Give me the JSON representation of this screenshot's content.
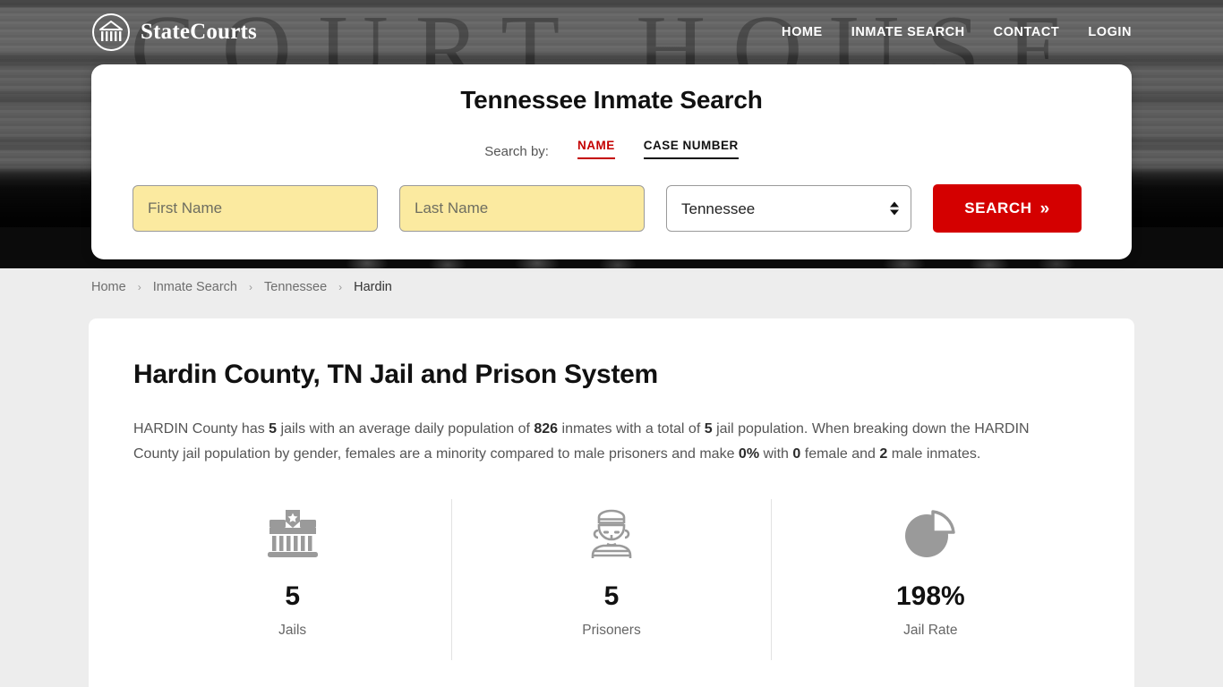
{
  "header": {
    "brand_name": "StateCourts",
    "logo_icon": "courthouse-circle-logo",
    "nav": [
      {
        "label": "HOME"
      },
      {
        "label": "INMATE SEARCH"
      },
      {
        "label": "CONTACT"
      },
      {
        "label": "LOGIN"
      }
    ],
    "background_ghost_text": "COURT HOUSE"
  },
  "search": {
    "title": "Tennessee Inmate Search",
    "search_by_label": "Search by:",
    "tabs": [
      {
        "label": "NAME",
        "active": true,
        "color": "#c40000"
      },
      {
        "label": "CASE NUMBER",
        "active": false,
        "color": "#111111"
      }
    ],
    "first_name": {
      "value": "",
      "placeholder": "First Name"
    },
    "last_name": {
      "value": "",
      "placeholder": "Last Name"
    },
    "state_select": {
      "selected": "Tennessee",
      "options": [
        "Tennessee"
      ]
    },
    "submit_label": "SEARCH",
    "submit_icon": "double-chevron-right-icon",
    "submit_color": "#d40000"
  },
  "breadcrumb": {
    "items": [
      {
        "label": "Home",
        "current": false
      },
      {
        "label": "Inmate Search",
        "current": false
      },
      {
        "label": "Tennessee",
        "current": false
      },
      {
        "label": "Hardin",
        "current": true
      }
    ],
    "separator": "›"
  },
  "main": {
    "page_title": "Hardin County, TN Jail and Prison System",
    "intro": {
      "p1": "HARDIN County has ",
      "b1": "5",
      "p2": " jails with an average daily population of ",
      "b2": "826",
      "p3": " inmates with a total of ",
      "b3": "5",
      "p4": " jail population. When breaking down the HARDIN County jail population by gender, females are a minority compared to male prisoners and make ",
      "b4": "0%",
      "p5": " with ",
      "b5": "0",
      "p6": " female and ",
      "b6": "2",
      "p7": " male inmates."
    },
    "stats": [
      {
        "icon": "jail-building-icon",
        "value": "5",
        "label": "Jails"
      },
      {
        "icon": "prisoner-icon",
        "value": "5",
        "label": "Prisoners"
      },
      {
        "icon": "pie-chart-icon",
        "value": "198%",
        "label": "Jail Rate"
      }
    ]
  }
}
